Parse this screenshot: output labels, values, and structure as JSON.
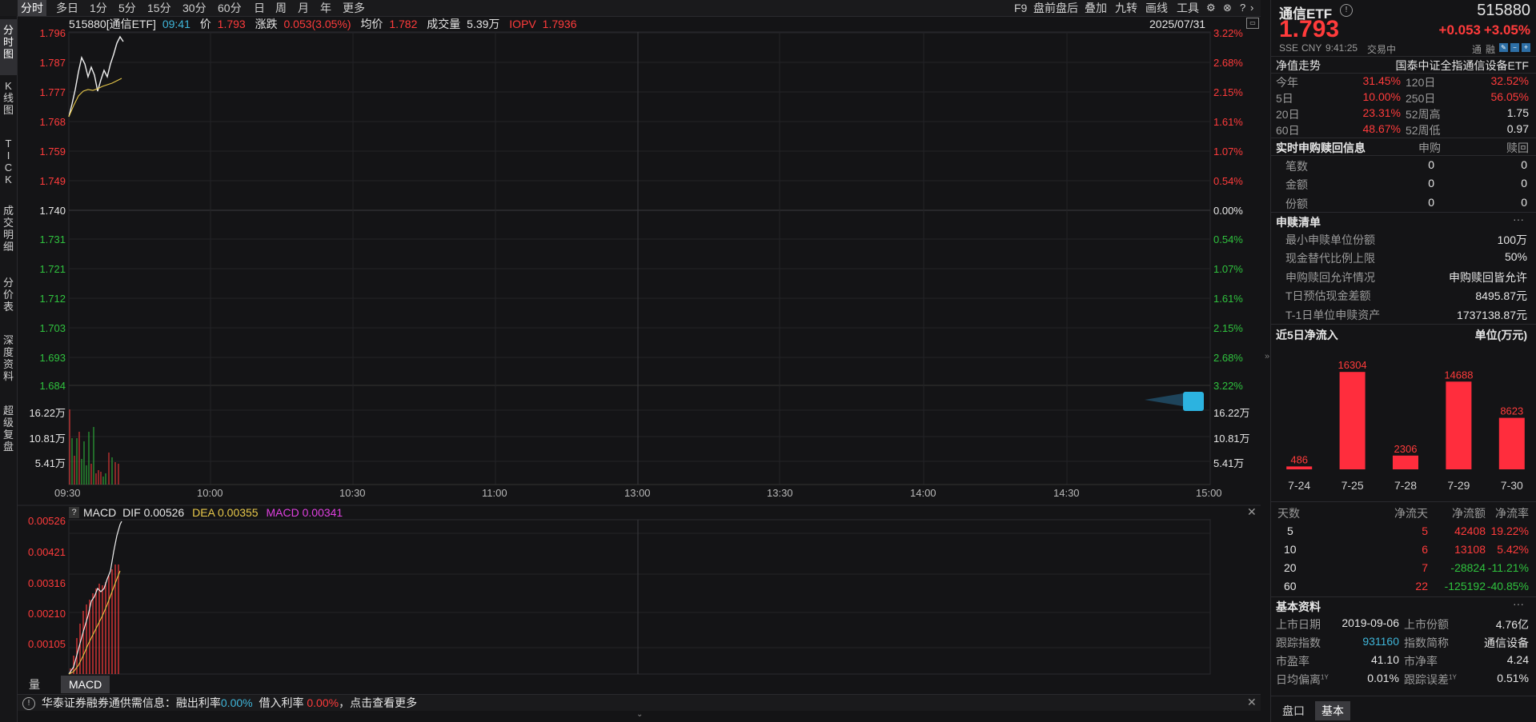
{
  "toolbar": {
    "periods": [
      "分时",
      "多日",
      "1分",
      "5分",
      "15分",
      "30分",
      "60分",
      "日",
      "周",
      "月",
      "年",
      "更多"
    ],
    "right_items": [
      "F9",
      "盘前盘后",
      "叠加",
      "九转",
      "画线",
      "工具"
    ]
  },
  "left_tabs": [
    "分时图",
    "K线图",
    "TICK",
    "成交明细",
    "分价表",
    "深度资料",
    "超级复盘"
  ],
  "info": {
    "code_name": "515880[通信ETF]",
    "time": "09:41",
    "price_label": "价",
    "price": "1.793",
    "change_label": "涨跌",
    "change": "0.053(3.05%)",
    "avg_label": "均价",
    "avg": "1.782",
    "volume_label": "成交量",
    "volume": "5.39万",
    "iopv_label": "IOPV",
    "iopv": "1.7936",
    "date": "2025/07/31"
  },
  "price_axis": {
    "left_labels": [
      "1.796",
      "1.787",
      "1.777",
      "1.768",
      "1.759",
      "1.749",
      "1.740",
      "1.731",
      "1.721",
      "1.712",
      "1.703",
      "1.693",
      "1.684"
    ],
    "right_labels": [
      "3.22%",
      "2.68%",
      "2.15%",
      "1.61%",
      "1.07%",
      "0.54%",
      "0.00%",
      "0.54%",
      "1.07%",
      "1.61%",
      "2.15%",
      "2.68%",
      "3.22%"
    ],
    "volume_labels": [
      "16.22万",
      "10.81万",
      "5.41万"
    ],
    "time_labels": [
      "09:30",
      "10:00",
      "10:30",
      "11:00",
      "13:00",
      "13:30",
      "14:00",
      "14:30",
      "15:00"
    ]
  },
  "macd": {
    "help": "?",
    "name": "MACD",
    "dif_label": "DIF",
    "dif": "0.00526",
    "dea_label": "DEA",
    "dea": "0.00355",
    "macd_label": "MACD",
    "macd_value": "0.00341",
    "axis_labels": [
      "0.00526",
      "0.00421",
      "0.00316",
      "0.00210",
      "0.00105"
    ]
  },
  "bottom_tabs": [
    "量比",
    "MACD"
  ],
  "notice": {
    "broker": "华泰证券融券通供需信息：融出利率",
    "lend_rate": "0.00%",
    "borrow_label": "借入利率",
    "borrow_rate": "0.00%",
    "more": "，点击查看更多"
  },
  "quote": {
    "name": "通信ETF",
    "code": "515880",
    "price": "1.793",
    "change": "+0.053",
    "change_pct": "+3.05%",
    "exchange": "SSE",
    "currency": "CNY",
    "time": "9:41:25",
    "status": "交易中",
    "tags": [
      "通",
      "融"
    ]
  },
  "nav": {
    "title": "净值走势",
    "index_name": "国泰中证全指通信设备ETF",
    "rows": [
      {
        "l1": "今年",
        "v1": "31.45%",
        "l2": "120日",
        "v2": "32.52%"
      },
      {
        "l1": "5日",
        "v1": "10.00%",
        "l2": "250日",
        "v2": "56.05%"
      },
      {
        "l1": "20日",
        "v1": "23.31%",
        "l2": "52周高",
        "v2": "1.75"
      },
      {
        "l1": "60日",
        "v1": "48.67%",
        "l2": "52周低",
        "v2": "0.97"
      }
    ]
  },
  "realtime": {
    "title": "实时申购赎回信息",
    "col1": "申购",
    "col2": "赎回",
    "rows": [
      {
        "label": "笔数",
        "buy": "0",
        "sell": "0"
      },
      {
        "label": "金额",
        "buy": "0",
        "sell": "0"
      },
      {
        "label": "份额",
        "buy": "0",
        "sell": "0"
      }
    ]
  },
  "redeem_list": {
    "title": "申赎清单",
    "more": "···",
    "rows": [
      {
        "label": "最小申赎单位份额",
        "value": "100万"
      },
      {
        "label": "现金替代比例上限",
        "value": "50%"
      },
      {
        "label": "申购赎回允许情况",
        "value": "申购赎回皆允许"
      },
      {
        "label": "T日预估现金差额",
        "value": "8495.87元"
      },
      {
        "label": "T-1日单位申赎资产",
        "value": "1737138.87元"
      }
    ]
  },
  "inflow": {
    "title": "近5日净流入",
    "unit": "单位(万元)"
  },
  "chart_data": {
    "type": "bar",
    "categories": [
      "7-24",
      "7-25",
      "7-28",
      "7-29",
      "7-30"
    ],
    "values": [
      486,
      16304,
      2306,
      14688,
      8623
    ],
    "title": "近5日净流入",
    "ylabel": "单位(万元)",
    "ylim": [
      0,
      17000
    ],
    "color": "#ff2d3d"
  },
  "flow_table": {
    "headers": [
      "天数",
      "净流天",
      "净流额",
      "净流率"
    ],
    "rows": [
      {
        "d": "5",
        "n": "5",
        "amt": "42408",
        "rate": "19.22%",
        "sign": "pos"
      },
      {
        "d": "10",
        "n": "6",
        "amt": "13108",
        "rate": "5.42%",
        "sign": "pos"
      },
      {
        "d": "20",
        "n": "7",
        "amt": "-28824",
        "rate": "-11.21%",
        "sign": "neg"
      },
      {
        "d": "60",
        "n": "22",
        "amt": "-125192",
        "rate": "-40.85%",
        "sign": "neg"
      }
    ]
  },
  "basics": {
    "title": "基本资料",
    "more": "···",
    "rows": [
      {
        "l1": "上市日期",
        "v1": "2019-09-06",
        "l2": "上市份额",
        "v2": "4.76亿"
      },
      {
        "l1": "跟踪指数",
        "v1": "931160",
        "l2": "指数简称",
        "v2": "通信设备"
      },
      {
        "l1": "市盈率",
        "v1": "41.10",
        "l2": "市净率",
        "v2": "4.24"
      },
      {
        "l1": "日均偏离",
        "v1": "0.01%",
        "l2": "跟踪误差",
        "v2": "0.51%"
      }
    ],
    "superscript": "1Y"
  },
  "right_tabs": [
    "盘口",
    "基本"
  ],
  "colors": {
    "up": "#ff3b3b",
    "down": "#2fc23e",
    "bg": "#141416"
  }
}
